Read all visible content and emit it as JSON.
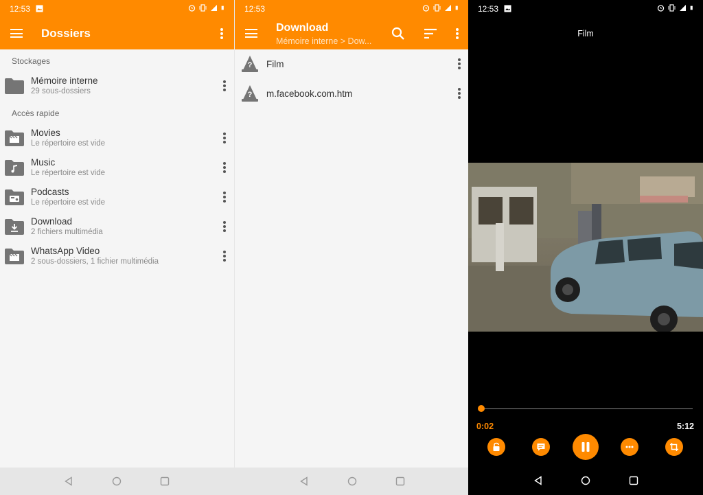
{
  "status": {
    "time": "12:53",
    "network": "4G"
  },
  "folders_screen": {
    "title": "Dossiers",
    "section_storage": "Stockages",
    "storage": [
      {
        "name": "Mémoire interne",
        "detail": "29 sous-dossiers",
        "icon": "folder-icon"
      }
    ],
    "section_quick": "Accès rapide",
    "quick": [
      {
        "name": "Movies",
        "detail": "Le répertoire est vide",
        "icon": "movie-folder-icon"
      },
      {
        "name": "Music",
        "detail": "Le répertoire est vide",
        "icon": "music-folder-icon"
      },
      {
        "name": "Podcasts",
        "detail": "Le répertoire est vide",
        "icon": "podcast-folder-icon"
      },
      {
        "name": "Download",
        "detail": "2 fichiers multimédia",
        "icon": "download-folder-icon"
      },
      {
        "name": "WhatsApp Video",
        "detail": "2 sous-dossiers, 1 fichier multimédia",
        "icon": "movie-folder-icon"
      }
    ]
  },
  "download_screen": {
    "title": "Download",
    "subtitle": "Mémoire interne > Dow...",
    "files": [
      {
        "name": "Film",
        "icon": "vlc-cone-icon"
      },
      {
        "name": "m.facebook.com.htm",
        "icon": "vlc-cone-icon"
      }
    ]
  },
  "player_screen": {
    "title": "Film",
    "current_time": "0:02",
    "duration": "5:12",
    "progress": 0.006,
    "controls": [
      "lock-icon",
      "subtitles-icon",
      "pause-icon",
      "more-icon",
      "crop-icon"
    ]
  },
  "colors": {
    "accent": "#ff8a00",
    "folder_gray": "#757575",
    "navbar_bg": "#e6e6e6"
  }
}
